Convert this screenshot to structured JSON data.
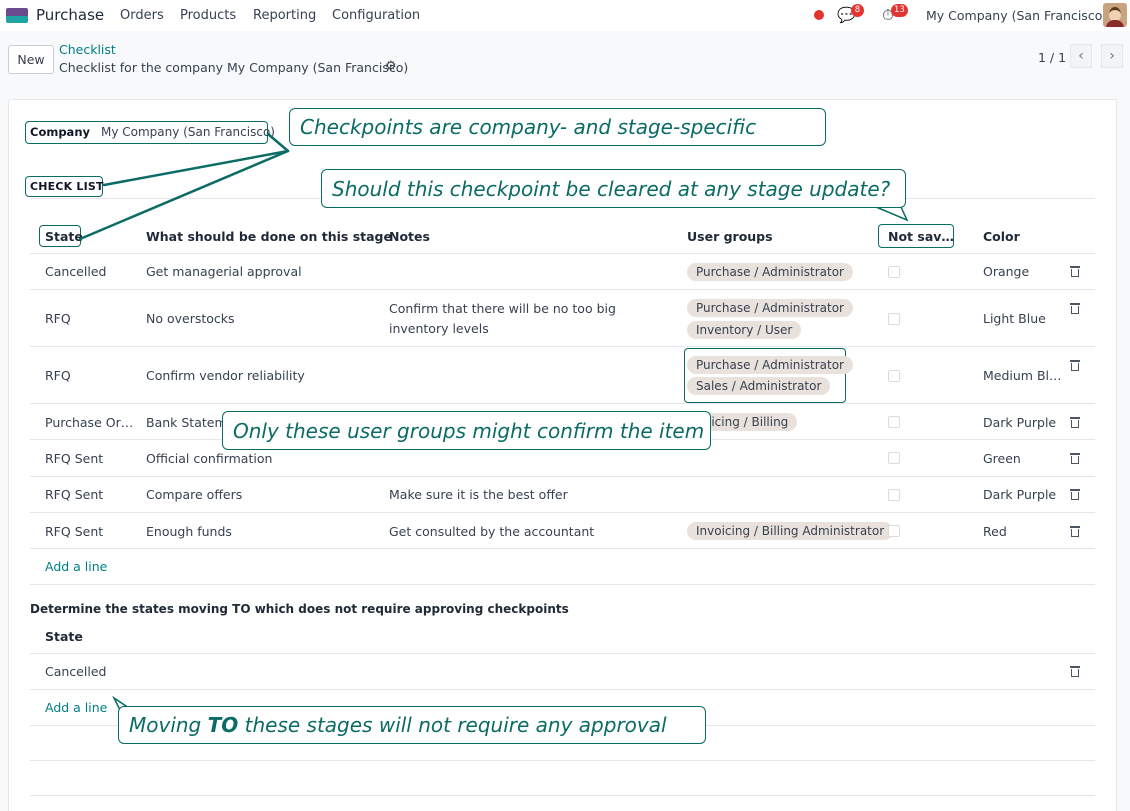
{
  "navbar": {
    "app_name": "Purchase",
    "menu": [
      "Orders",
      "Products",
      "Reporting",
      "Configuration"
    ],
    "messages_count": "8",
    "activities_count": "13",
    "company": "My Company (San Francisco)"
  },
  "control": {
    "new_label": "New",
    "breadcrumb_link": "Checklist",
    "record_title": "Checklist for the company My Company (San Francisco)",
    "pager": "1 / 1"
  },
  "form": {
    "company_label": "Company",
    "company_value": "My Company (San Francisco)",
    "checklist_label": "CHECK LIST",
    "columns": [
      "State",
      "What should be done on this stage",
      "Notes",
      "User groups",
      "Not sav…",
      "Color"
    ],
    "rows": [
      {
        "state": "Cancelled",
        "task": "Get managerial approval",
        "notes": "",
        "groups": [
          "Purchase / Administrator"
        ],
        "color": "Orange"
      },
      {
        "state": "RFQ",
        "task": "No overstocks",
        "notes": "Confirm that there will be no too big inventory levels",
        "groups": [
          "Purchase / Administrator",
          "Inventory / User"
        ],
        "color": "Light Blue"
      },
      {
        "state": "RFQ",
        "task": "Confirm vendor reliability",
        "notes": "",
        "groups": [
          "Purchase / Administrator",
          "Sales / Administrator"
        ],
        "color": "Medium Bl…"
      },
      {
        "state": "Purchase Or…",
        "task": "Bank Statem",
        "notes": "",
        "groups": [
          "oicing / Billing"
        ],
        "color": "Dark Purple"
      },
      {
        "state": "RFQ Sent",
        "task": "Official confirmation",
        "notes": "",
        "groups": [],
        "color": "Green"
      },
      {
        "state": "RFQ Sent",
        "task": "Compare offers",
        "notes": "Make sure it is the best offer",
        "groups": [],
        "color": "Dark Purple"
      },
      {
        "state": "RFQ Sent",
        "task": "Enough funds",
        "notes": "Get consulted by the accountant",
        "groups": [
          "Invoicing / Billing Administrator"
        ],
        "color": "Red"
      }
    ],
    "add_line": "Add a line",
    "no_approval_title": "Determine the states moving TO which does not require approving checkpoints",
    "no_approval_column": "State",
    "no_approval_rows": [
      "Cancelled"
    ]
  },
  "callouts": {
    "company": "Checkpoints are company- and stage-specific",
    "not_saved": "Should this checkpoint be cleared at any stage update?",
    "groups": "Only these user groups might confirm the item",
    "moving_pre": "Moving ",
    "moving_bold": "TO",
    "moving_post": " these stages will not require any approval"
  },
  "colors": {
    "accent": "#017e84",
    "callout": "#0b6b65",
    "tag_bg": "#e9e1dc",
    "badge": "#e3342f"
  }
}
